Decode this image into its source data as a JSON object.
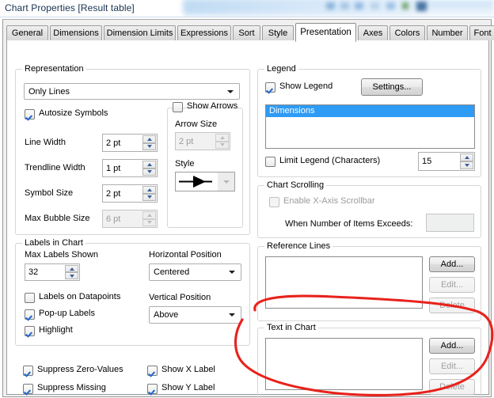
{
  "window": {
    "title": "Chart Properties [Result table]"
  },
  "tabs": [
    {
      "label": "General",
      "active": false
    },
    {
      "label": "Dimensions",
      "active": false
    },
    {
      "label": "Dimension Limits",
      "active": false
    },
    {
      "label": "Expressions",
      "active": false
    },
    {
      "label": "Sort",
      "active": false
    },
    {
      "label": "Style",
      "active": false
    },
    {
      "label": "Presentation",
      "active": true
    },
    {
      "label": "Axes",
      "active": false
    },
    {
      "label": "Colors",
      "active": false
    },
    {
      "label": "Number",
      "active": false
    },
    {
      "label": "Font",
      "active": false
    }
  ],
  "representation": {
    "caption": "Representation",
    "type_value": "Only Lines",
    "autosize_symbols": {
      "label": "Autosize Symbols",
      "checked": true
    },
    "line_width": {
      "label": "Line Width",
      "value": "2 pt"
    },
    "trendline_width": {
      "label": "Trendline Width",
      "value": "1 pt"
    },
    "symbol_size": {
      "label": "Symbol Size",
      "value": "2 pt"
    },
    "max_bubble_size": {
      "label": "Max Bubble Size",
      "value": "6 pt",
      "disabled": true
    },
    "show_arrows": {
      "label": "Show Arrows",
      "checked": false
    },
    "arrow_size": {
      "label": "Arrow Size",
      "value": "2 pt",
      "disabled": true
    },
    "style": {
      "label": "Style",
      "value": "arrow-line-glyph"
    }
  },
  "labels_in_chart": {
    "caption": "Labels in Chart",
    "max_labels_shown": {
      "label": "Max Labels Shown",
      "value": "32"
    },
    "horizontal_position": {
      "label": "Horizontal Position",
      "value": "Centered"
    },
    "vertical_position": {
      "label": "Vertical Position",
      "value": "Above"
    },
    "labels_on_datapoints": {
      "label": "Labels on Datapoints",
      "checked": false
    },
    "popup_labels": {
      "label": "Pop-up Labels",
      "checked": true
    },
    "highlight": {
      "label": "Highlight",
      "checked": true
    }
  },
  "bottom_left_options": {
    "suppress_zero_values": {
      "label": "Suppress Zero-Values",
      "checked": true
    },
    "suppress_missing": {
      "label": "Suppress Missing",
      "checked": true
    },
    "show_x_label": {
      "label": "Show X Label",
      "checked": true
    },
    "show_y_label": {
      "label": "Show Y Label",
      "checked": true
    }
  },
  "legend": {
    "caption": "Legend",
    "show_legend": {
      "label": "Show Legend",
      "checked": true
    },
    "settings_button": "Settings...",
    "items": [
      "Dimensions"
    ],
    "selected_item": "Dimensions",
    "limit_legend": {
      "label": "Limit Legend (Characters)",
      "checked": false,
      "value": "15"
    }
  },
  "chart_scrolling": {
    "caption": "Chart Scrolling",
    "enable_x_axis_scrollbar": {
      "label": "Enable X-Axis Scrollbar",
      "checked": false,
      "disabled": true
    },
    "when_exceeds": {
      "label": "When Number of Items Exceeds:",
      "value": "",
      "disabled": true
    }
  },
  "reference_lines": {
    "caption": "Reference Lines",
    "items": [],
    "add_button": "Add...",
    "edit_button": "Edit...",
    "delete_button": "Delete"
  },
  "text_in_chart": {
    "caption": "Text in Chart",
    "items": [],
    "add_button": "Add...",
    "edit_button": "Edit...",
    "delete_button": "Delete"
  },
  "annotation": {
    "shape": "red-ellipse-highlight",
    "color": "#e8221c",
    "targets": "text-in-chart-group"
  },
  "colors": {
    "selection_blue": "#2e9bf5",
    "title_text": "#16314f",
    "annotation_red": "#e8221c",
    "dialog_face": "#f0f0f0"
  }
}
